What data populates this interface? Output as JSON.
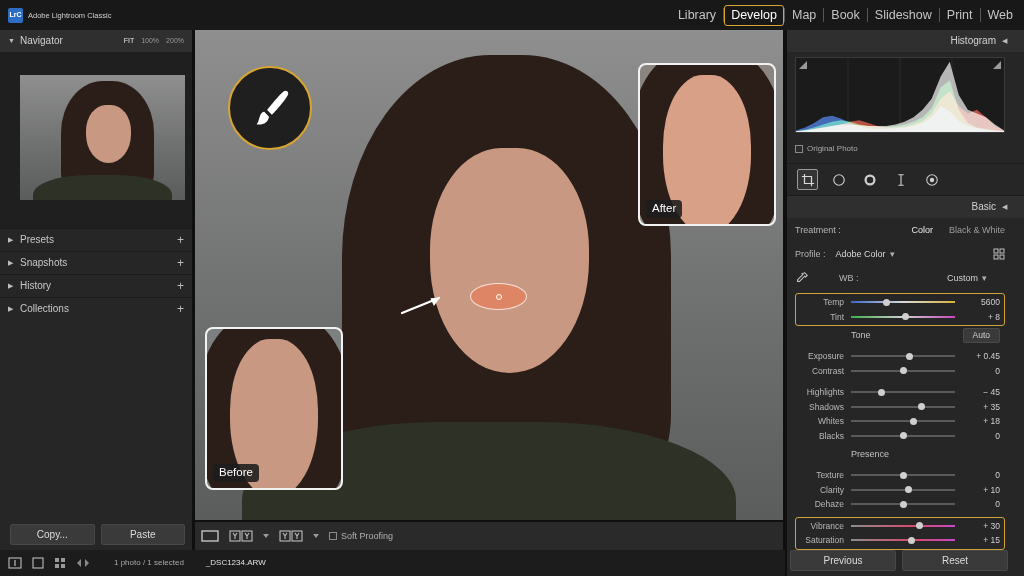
{
  "app": {
    "badge": "LrC",
    "title": "Adobe Lightroom Classic"
  },
  "modules": [
    {
      "label": "Library",
      "selected": false
    },
    {
      "label": "Develop",
      "selected": true
    },
    {
      "label": "Map",
      "selected": false
    },
    {
      "label": "Book",
      "selected": false
    },
    {
      "label": "Slideshow",
      "selected": false
    },
    {
      "label": "Print",
      "selected": false
    },
    {
      "label": "Web",
      "selected": false
    }
  ],
  "navigator": {
    "toggle": "▼",
    "title": "Navigator",
    "zoom": [
      {
        "label": "FIT",
        "selected": true
      },
      {
        "label": "100%",
        "selected": false
      },
      {
        "label": "200%",
        "selected": false
      }
    ]
  },
  "left_sections": [
    {
      "toggle": "▶",
      "label": "Presets",
      "add": "+"
    },
    {
      "toggle": "▶",
      "label": "Snapshots",
      "add": "+"
    },
    {
      "toggle": "▶",
      "label": "History",
      "add": "+"
    },
    {
      "toggle": "▶",
      "label": "Collections",
      "add": "+"
    }
  ],
  "left_buttons": [
    "Copy...",
    "Paste"
  ],
  "canvas": {
    "before": "Before",
    "after": "After"
  },
  "toolbar": {
    "soft_proofing": {
      "label": "Soft Proofing",
      "checked": false
    }
  },
  "status_bar": {
    "count": "1 photo / 1 selected",
    "filename": "_DSC1234.ARW"
  },
  "histogram": {
    "title": "Histogram",
    "toggle": "◀",
    "series": [
      {
        "color": "#3a6fd8",
        "values": [
          0.02,
          0.06,
          0.12,
          0.2,
          0.22,
          0.18,
          0.12,
          0.08,
          0.05,
          0.04,
          0.04,
          0.05,
          0.06,
          0.08,
          0.12,
          0.2,
          0.35,
          0.28,
          0.15,
          0.08,
          0.05,
          0.03,
          0.02,
          0.01
        ]
      },
      {
        "color": "#3fbf55",
        "values": [
          0.01,
          0.03,
          0.06,
          0.1,
          0.14,
          0.16,
          0.14,
          0.1,
          0.08,
          0.07,
          0.07,
          0.08,
          0.1,
          0.14,
          0.2,
          0.32,
          0.6,
          0.7,
          0.3,
          0.12,
          0.06,
          0.04,
          0.02,
          0.01
        ]
      },
      {
        "color": "#d84a3a",
        "values": [
          0.01,
          0.02,
          0.04,
          0.06,
          0.08,
          0.1,
          0.14,
          0.16,
          0.12,
          0.08,
          0.06,
          0.06,
          0.07,
          0.1,
          0.15,
          0.25,
          0.45,
          0.55,
          0.35,
          0.25,
          0.3,
          0.2,
          0.08,
          0.02
        ]
      },
      {
        "color": "#d8d8d8",
        "values": [
          0.01,
          0.02,
          0.04,
          0.06,
          0.08,
          0.1,
          0.1,
          0.09,
          0.08,
          0.08,
          0.08,
          0.1,
          0.14,
          0.2,
          0.3,
          0.45,
          0.75,
          0.95,
          0.5,
          0.3,
          0.25,
          0.2,
          0.1,
          0.02
        ]
      }
    ],
    "original_photo": {
      "label": "Original Photo",
      "checked": false
    }
  },
  "tools": [
    {
      "kind": "crop",
      "selected": true
    },
    {
      "kind": "spot",
      "selected": false
    },
    {
      "kind": "redeye",
      "selected": false
    },
    {
      "kind": "graduated",
      "selected": false
    },
    {
      "kind": "radial",
      "selected": false
    }
  ],
  "basic": {
    "title": "Basic",
    "toggle": "◀",
    "treatment": {
      "label": "Treatment :",
      "options": [
        {
          "label": "Color",
          "selected": true
        },
        {
          "label": "Black & White",
          "selected": false
        }
      ]
    },
    "profile": {
      "label": "Profile :",
      "value": "Adobe Color",
      "caret": "▾"
    },
    "wb": {
      "label": "WB :",
      "value": "Custom",
      "caret": "▾"
    },
    "groups": [
      {
        "highlighted": true,
        "sliders": [
          {
            "label": "Temp",
            "value": "5600",
            "level": 0.34,
            "kind": "temp"
          },
          {
            "label": "Tint",
            "value": "+ 8",
            "level": 0.52,
            "kind": "tint"
          }
        ]
      },
      {
        "heading": "Tone",
        "button": "Auto",
        "highlighted": false,
        "sliders": [
          {
            "label": "Exposure",
            "value": "+ 0.45",
            "level": 0.56,
            "kind": "plain"
          },
          {
            "label": "Contrast",
            "value": "0",
            "level": 0.5,
            "kind": "plain"
          }
        ]
      },
      {
        "highlighted": false,
        "sliders": [
          {
            "label": "Highlights",
            "value": "− 45",
            "level": 0.29,
            "kind": "plain"
          },
          {
            "label": "Shadows",
            "value": "+ 35",
            "level": 0.68,
            "kind": "plain"
          },
          {
            "label": "Whites",
            "value": "+ 18",
            "level": 0.6,
            "kind": "plain"
          },
          {
            "label": "Blacks",
            "value": "0",
            "level": 0.5,
            "kind": "plain"
          }
        ]
      },
      {
        "heading": "Presence",
        "highlighted": false,
        "sliders": [
          {
            "label": "Texture",
            "value": "0",
            "level": 0.5,
            "kind": "plain"
          },
          {
            "label": "Clarity",
            "value": "+ 10",
            "level": 0.55,
            "kind": "plain"
          },
          {
            "label": "Dehaze",
            "value": "0",
            "level": 0.5,
            "kind": "plain"
          }
        ]
      },
      {
        "highlighted": true,
        "sliders": [
          {
            "label": "Vibrance",
            "value": "+ 30",
            "level": 0.66,
            "kind": "color"
          },
          {
            "label": "Saturation",
            "value": "+ 15",
            "level": 0.58,
            "kind": "color"
          }
        ]
      }
    ]
  },
  "footer_buttons": [
    "Previous",
    "Reset"
  ]
}
